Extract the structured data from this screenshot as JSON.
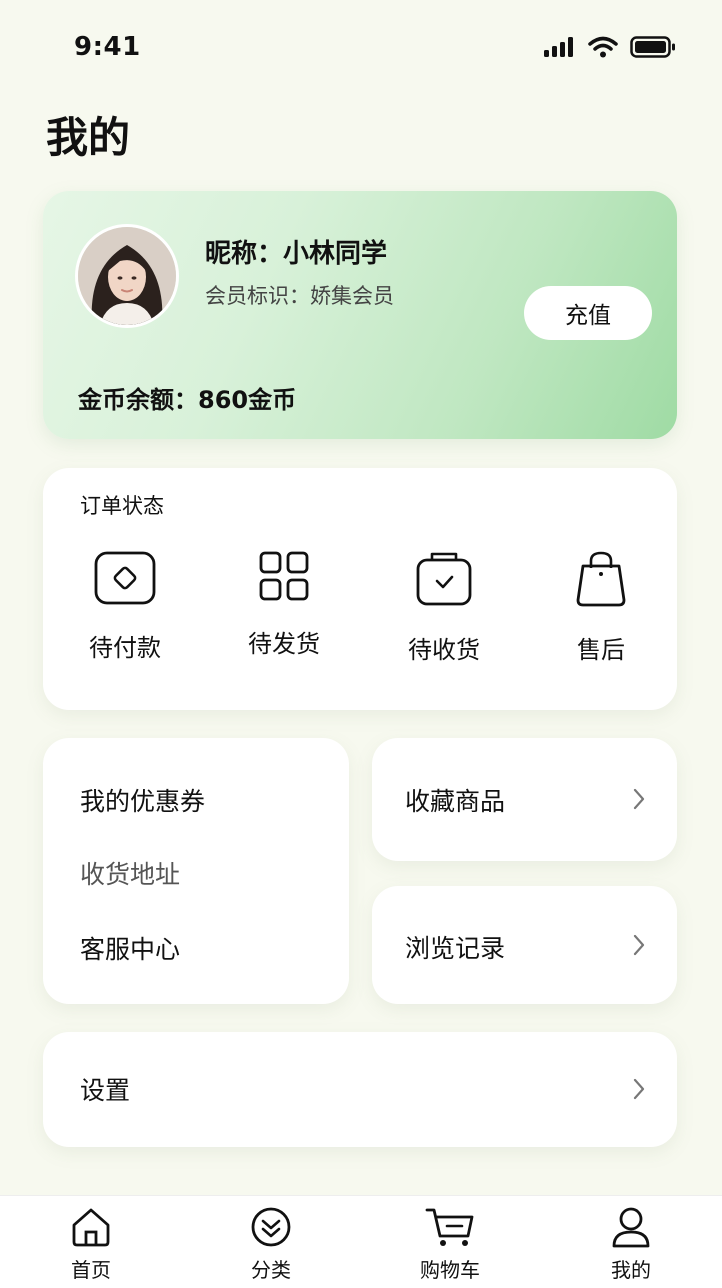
{
  "status": {
    "time": "9:41"
  },
  "page": {
    "title": "我的"
  },
  "profile": {
    "nickname": "昵称：小林同学",
    "member": "会员标识：娇集会员",
    "recharge_label": "充值",
    "balance": "金币余额：860金币"
  },
  "orders": {
    "title": "订单状态",
    "items": [
      {
        "label": "待付款",
        "icon": "wallet-icon"
      },
      {
        "label": "待发货",
        "icon": "grid-icon"
      },
      {
        "label": "待收货",
        "icon": "package-check-icon"
      },
      {
        "label": "售后",
        "icon": "shopping-bag-icon"
      }
    ]
  },
  "menu": {
    "coupons": "我的优惠券",
    "address": "收货地址",
    "service": "客服中心",
    "favorites": "收藏商品",
    "history": "浏览记录",
    "settings": "设置"
  },
  "tabbar": {
    "items": [
      {
        "label": "首页",
        "icon": "home-icon"
      },
      {
        "label": "分类",
        "icon": "category-icon"
      },
      {
        "label": "购物车",
        "icon": "cart-icon"
      },
      {
        "label": "我的",
        "icon": "user-icon"
      }
    ]
  },
  "colors": {
    "accent_green": "#9fdba4",
    "background": "#f7f9ef"
  }
}
